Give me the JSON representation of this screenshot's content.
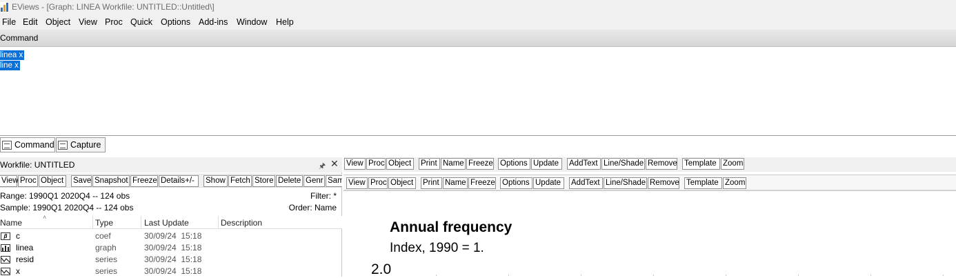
{
  "window": {
    "title": "EViews - [Graph: LINEA    Workfile: UNTITLED::Untitled\\]"
  },
  "menu": [
    "File",
    "Edit",
    "Object",
    "View",
    "Proc",
    "Quick",
    "Options",
    "Add-ins",
    "Window",
    "Help"
  ],
  "command_pane": {
    "header": "Command",
    "lines": [
      "linea x",
      "line x"
    ]
  },
  "tabs": [
    "Command",
    "Capture"
  ],
  "workfile": {
    "title": "Workfile: UNTITLED",
    "toolbar": [
      "View",
      "Proc",
      "Object",
      "Save",
      "Snapshot",
      "Freeze",
      "Details+/-",
      "Show",
      "Fetch",
      "Store",
      "Delete",
      "Genr",
      "Sam"
    ],
    "range": "Range:  1990Q1 2020Q4   --   124 obs",
    "sample": "Sample: 1990Q1 2020Q4   --   124 obs",
    "filter": "Filter: *",
    "order": "Order: Name",
    "columns": [
      "Name",
      "Type",
      "Last Update",
      "Description"
    ],
    "rows": [
      {
        "icon": "coef-icon",
        "name": "c",
        "type": "coef",
        "updated": "30/09/24  15:18"
      },
      {
        "icon": "graph-icon",
        "name": "linea",
        "type": "graph",
        "updated": "30/09/24  15:18"
      },
      {
        "icon": "series-icon",
        "name": "resid",
        "type": "series",
        "updated": "30/09/24  15:18"
      },
      {
        "icon": "series-icon",
        "name": "x",
        "type": "series",
        "updated": "30/09/24  15:18"
      }
    ]
  },
  "graph": {
    "toolbar": [
      "View",
      "Proc",
      "Object",
      "Print",
      "Name",
      "Freeze",
      "Options",
      "Update",
      "AddText",
      "Line/Shade",
      "Remove",
      "Template",
      "Zoom"
    ],
    "title": "Annual frequency",
    "subtitle": "Index, 1990 = 1.",
    "y_tick_top": "2.0"
  },
  "colors": {
    "selection": "#0a6fd6",
    "chrome": "#f0f0f0"
  }
}
